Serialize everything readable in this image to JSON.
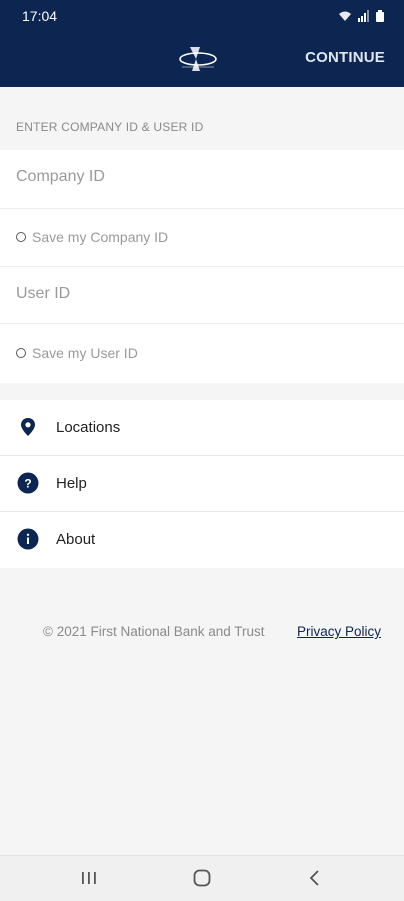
{
  "status_bar": {
    "time": "17:04"
  },
  "app_bar": {
    "logo": "bank-logo",
    "continue_label": "CONTINUE"
  },
  "form": {
    "section_label": "ENTER COMPANY ID & USER ID",
    "company_id_placeholder": "Company ID",
    "save_company_label": "Save my Company ID",
    "user_id_placeholder": "User ID",
    "save_user_label": "Save my User ID"
  },
  "menu": {
    "items": [
      {
        "label": "Locations",
        "icon": "location-pin-icon"
      },
      {
        "label": "Help",
        "icon": "help-icon"
      },
      {
        "label": "About",
        "icon": "info-icon"
      }
    ]
  },
  "footer": {
    "copyright": "© 2021 First National Bank and Trust",
    "privacy_label": "Privacy Policy"
  },
  "colors": {
    "brand": "#0c2551"
  }
}
